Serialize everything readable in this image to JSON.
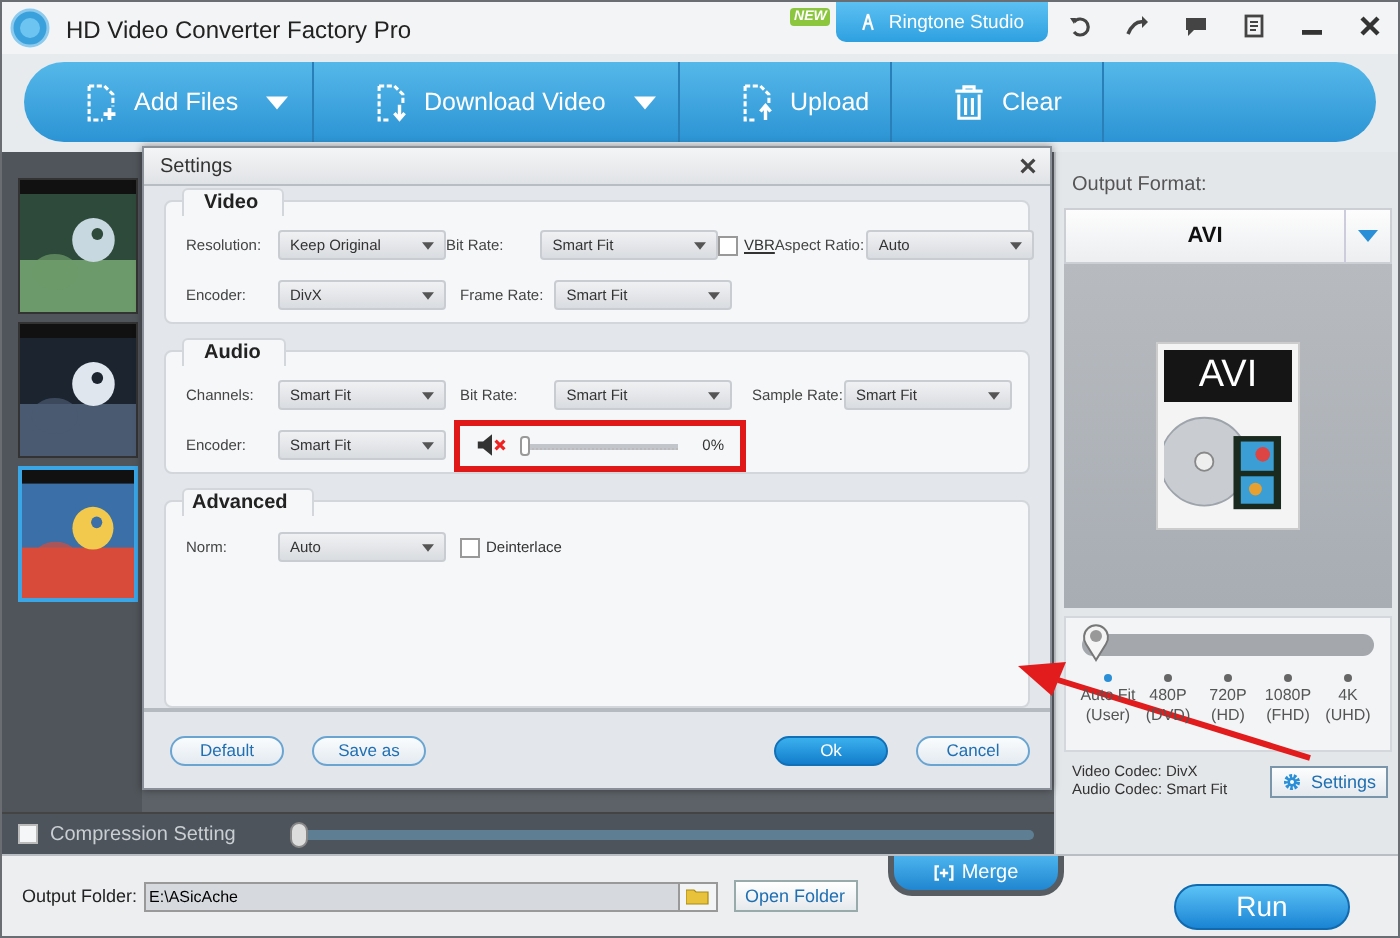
{
  "window": {
    "title": "HD Video Converter Factory Pro",
    "badge": "NEW",
    "feature_button": "Ringtone Studio"
  },
  "toolbar": [
    {
      "label": "Add Files",
      "dropdown": true
    },
    {
      "label": "Download Video",
      "dropdown": true
    },
    {
      "label": "Upload",
      "dropdown": false
    },
    {
      "label": "Clear",
      "dropdown": false
    }
  ],
  "files": [
    {
      "kind": "picture",
      "selected": false
    },
    {
      "kind": "picture",
      "selected": false
    },
    {
      "kind": "picture",
      "selected": true
    }
  ],
  "compression": {
    "label": "Compression Setting",
    "checked": false,
    "level": 0
  },
  "settings_dialog": {
    "title": "Settings",
    "groups": [
      {
        "title": "Video",
        "rows": [
          [
            {
              "kind": "select",
              "label": "Resolution:",
              "value": "Keep Original"
            },
            {
              "kind": "select",
              "label": "Bit Rate:",
              "value": "Smart Fit"
            },
            {
              "kind": "checkbox",
              "label": "VBR",
              "checked": false
            },
            {
              "kind": "select",
              "label": "Aspect Ratio:",
              "value": "Auto"
            }
          ],
          [
            {
              "kind": "select",
              "label": "Encoder:",
              "value": "DivX"
            },
            {
              "kind": "select",
              "label": "Frame Rate:",
              "value": "Smart Fit"
            }
          ]
        ]
      },
      {
        "title": "Audio",
        "rows": [
          [
            {
              "kind": "select",
              "label": "Channels:",
              "value": "Smart Fit"
            },
            {
              "kind": "select",
              "label": "Bit Rate:",
              "value": "Smart Fit"
            },
            {
              "kind": "select",
              "label": "Sample Rate:",
              "value": "Smart Fit"
            }
          ],
          [
            {
              "kind": "select",
              "label": "Encoder:",
              "value": "Smart Fit"
            },
            {
              "kind": "volume",
              "muted": true,
              "level": 0,
              "reading": "0%",
              "highlighted": true
            }
          ]
        ]
      },
      {
        "title": "Advanced",
        "rows": [
          [
            {
              "kind": "select",
              "label": "Norm:",
              "value": "Auto"
            },
            {
              "kind": "checkbox",
              "label": "Deinterlace",
              "checked": false
            }
          ]
        ]
      }
    ],
    "buttons": [
      {
        "label": "Default",
        "primary": false
      },
      {
        "label": "Save as",
        "primary": false
      },
      {
        "label": "Ok",
        "primary": true
      },
      {
        "label": "Cancel",
        "primary": false
      }
    ]
  },
  "output_format": {
    "label": "Output Format:",
    "format": "AVI",
    "icon_text": "AVI",
    "quality": {
      "level": 0,
      "options": [
        {
          "line1": "Auto Fit",
          "line2": "(User)",
          "selected": true
        },
        {
          "line1": "480P",
          "line2": "(DVD)",
          "selected": false
        },
        {
          "line1": "720P",
          "line2": "(HD)",
          "selected": false
        },
        {
          "line1": "1080P",
          "line2": "(FHD)",
          "selected": false
        },
        {
          "line1": "4K",
          "line2": "(UHD)",
          "selected": false
        }
      ]
    },
    "codecs": [
      "Video Codec: DivX",
      "Audio Codec: Smart Fit"
    ],
    "settings_button": "Settings"
  },
  "bottom": {
    "folder_label": "Output Folder:",
    "folder_value": "E:\\ASicAche",
    "open_folder": "Open Folder",
    "merge": "Merge",
    "run": "Run"
  },
  "annotation": {
    "arrow": true
  }
}
